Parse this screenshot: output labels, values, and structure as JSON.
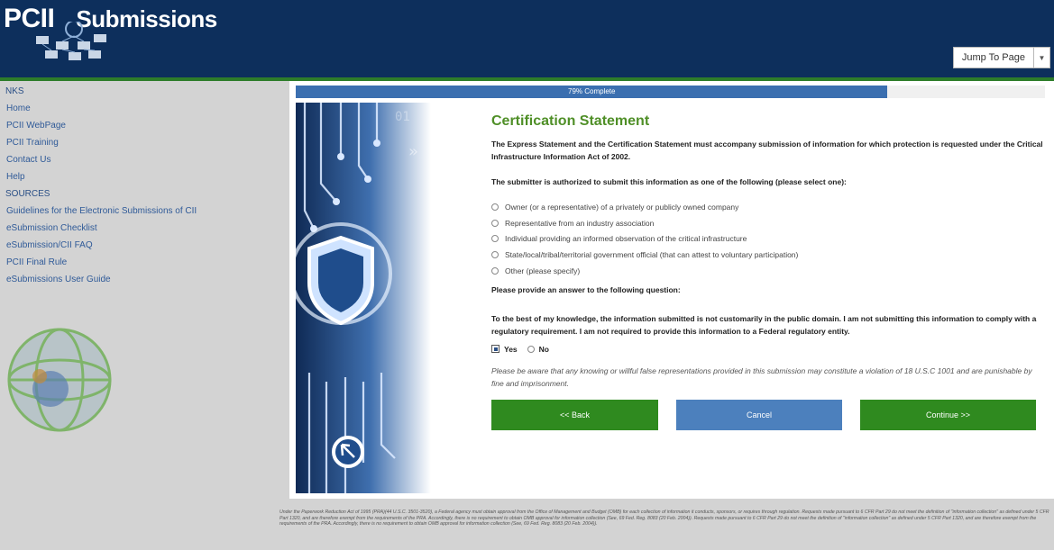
{
  "header": {
    "brand_left": "PCII",
    "brand_right": "Submissions",
    "jump_label": "Jump To Page"
  },
  "sidebar": {
    "links_heading": "NKS",
    "links": [
      "Home",
      "PCII WebPage",
      "PCII Training",
      "Contact Us",
      "Help"
    ],
    "resources_heading": "SOURCES",
    "resources": [
      "Guidelines for the Electronic Submissions of CII",
      "eSubmission Checklist",
      "eSubmission/CII FAQ",
      "PCII Final Rule",
      "eSubmissions User Guide"
    ]
  },
  "progress": {
    "label": "79% Complete",
    "value": 0.79
  },
  "form": {
    "title": "Certification Statement",
    "intro": "The Express Statement and the Certification Statement must accompany submission of information for which protection is requested under the Critical Infrastructure Information Act of 2002.",
    "q1": "The submitter is authorized to submit this information as one of the following (please select one):",
    "options": [
      "Owner (or a representative) of a privately or publicly owned company",
      "Representative from an industry association",
      "Individual providing an informed observation of the critical infrastructure",
      "State/local/tribal/territorial government official (that can attest to voluntary participation)",
      "Other (please specify)"
    ],
    "q2_heading": "Please provide an answer to the following question:",
    "q2_text": "To the best of my knowledge, the information submitted is not customarily in the public domain. I am not submitting this information to comply with a regulatory requirement. I am not required to provide this information to a Federal regulatory entity.",
    "yes_label": "Yes",
    "no_label": "No",
    "note": "Please be aware that any knowing or willful false representations provided in this submission may constitute a violation of 18 U.S.C 1001 and are punishable by fine and imprisonment.",
    "back_label": "<< Back",
    "cancel_label": "Cancel",
    "continue_label": "Continue >>"
  },
  "footer": "Under the Paperwork Reduction Act of 1995 (PRA)(44 U.S.C. 3501-3520), a Federal agency must obtain approval from the Office of Management and Budget (OMB) for each collection of information it conducts, sponsors, or requires through regulation. Requests made pursuant to 6 CFR Part 29 do not meet the definition of \"information collection\" as defined under 5 CFR Part 1320, and are therefore exempt from the requirements of the PRA. Accordingly, there is no requirement to obtain OMB approval for information collection (See, 69 Fed. Reg. 8083 (20 Feb. 2004)). Requests made pursuant to 6 CFR Part 29 do not meet the definition of \"information collection\" as defined under 5 CFR Part 1320, and are therefore exempt from the requirements of the PRA. Accordingly, there is no requirement to obtain OMB approval for information collection (See, 69 Fed. Reg. 8083 (20 Feb. 2004)).",
  "colors": {
    "header": "#0d2f5c",
    "accent_green": "#2f8a1f",
    "title_green": "#4f8f27",
    "cancel_blue": "#4c80bd",
    "progress_blue": "#3b6fb0"
  },
  "icons": [
    "shield-icon",
    "cursor-icon",
    "globe-icon",
    "network-logo-icon"
  ]
}
